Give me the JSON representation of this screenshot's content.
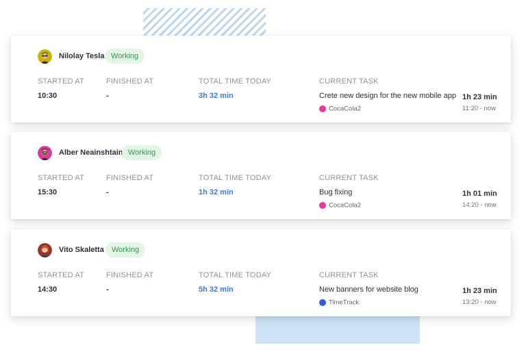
{
  "columns": {
    "started": "STARTED AT",
    "finished": "FINISHED AT",
    "total": "TOTAL TIME TODAY",
    "task": "CURRENT TASK"
  },
  "employees": [
    {
      "name": "Nilolay Tesla",
      "status": "Working",
      "started_at": "10:30",
      "finished_at": "-",
      "total_time": "3h 32 min",
      "task": "Crete new design for the new mobile app",
      "project": "CocaCola2",
      "project_color": "#e8399a",
      "task_duration": "1h 23 min",
      "task_range": "11:20 - now",
      "avatar_icon": "avatar-man-sunglasses"
    },
    {
      "name": "Alber Neainshtain",
      "status": "Working",
      "started_at": "15:30",
      "finished_at": "-",
      "total_time": "1h 32 min",
      "task": "Bug fixing",
      "project": "CocaCola2",
      "project_color": "#e8399a",
      "task_duration": "1h 01 min",
      "task_range": "14:20 - now",
      "avatar_icon": "avatar-man-beard"
    },
    {
      "name": "Vito Skaletta",
      "status": "Working",
      "started_at": "14:30",
      "finished_at": "-",
      "total_time": "5h 32 min",
      "task": "New banners for website blog",
      "project": "TimeTrack",
      "project_color": "#2f5fe0",
      "task_duration": "1h 23 min",
      "task_range": "13:20 - now",
      "avatar_icon": "avatar-woman-red-hair"
    }
  ],
  "colors": {
    "status_bg": "#e3f5e6",
    "status_text": "#2e9a43",
    "total_time_text": "#3a7ad8"
  }
}
